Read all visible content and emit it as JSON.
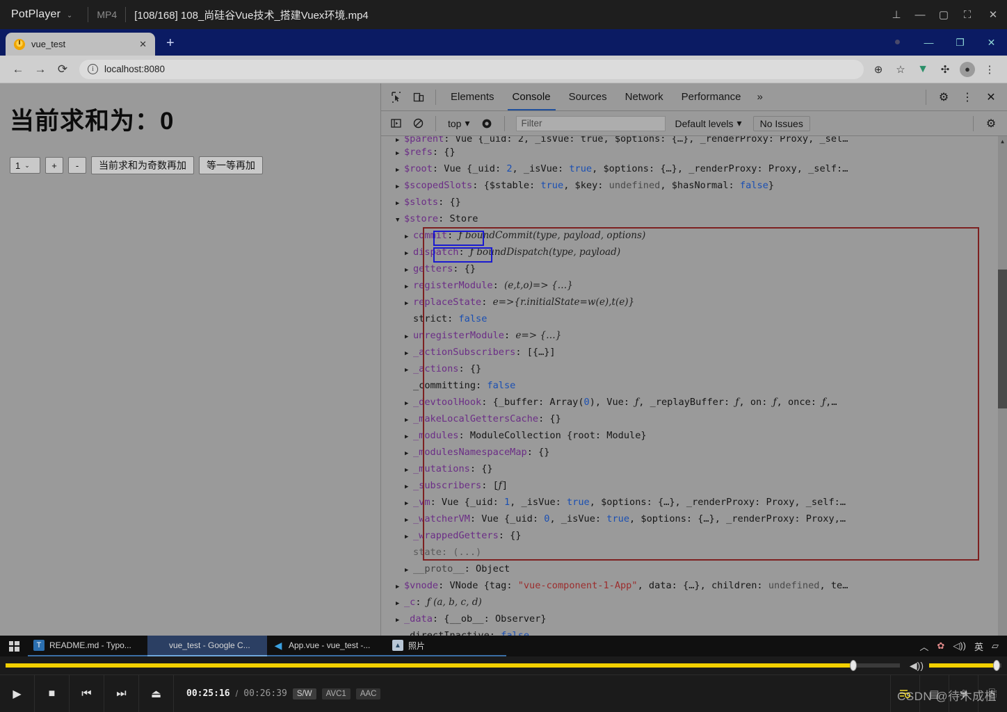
{
  "potplayer": {
    "app_name": "PotPlayer",
    "caret": "⌄",
    "format": "MP4",
    "title": "[108/168] 108_尚硅谷Vue技术_搭建Vuex环境.mp4",
    "window_buttons": [
      {
        "name": "pin",
        "glyph": "⊥"
      },
      {
        "name": "minimize",
        "glyph": "—"
      },
      {
        "name": "maximize",
        "glyph": "▢"
      },
      {
        "name": "fullscreen",
        "glyph": "⛶"
      },
      {
        "name": "close",
        "glyph": "✕"
      }
    ],
    "controls": {
      "play": "▶",
      "stop": "■",
      "previous": "⏮",
      "next": "⏭",
      "eject": "⏏",
      "current_time": "00:25:16",
      "separator": "/",
      "total_time": "00:26:39",
      "chips": [
        "S/W",
        "AVC1",
        "AAC"
      ],
      "seek_percent": 94.8,
      "volume_percent": 93,
      "volume_icon": "🔊",
      "right_icons": [
        "playlist-icon",
        "bookmark-icon",
        "settings-icon",
        "expand-icon"
      ]
    },
    "watermark": "CSDN @待木成植"
  },
  "chrome": {
    "tab": {
      "title": "vue_test",
      "close": "✕"
    },
    "new_tab": "+",
    "window_buttons": [
      {
        "name": "record",
        "glyph": "●"
      },
      {
        "name": "minimize",
        "glyph": "—"
      },
      {
        "name": "restore",
        "glyph": "❐"
      },
      {
        "name": "close",
        "glyph": "✕"
      }
    ],
    "toolbar": {
      "back": "←",
      "forward": "→",
      "reload": "⟳",
      "url": "localhost:8080",
      "info_glyph": "ⓘ",
      "zoom": "⊕",
      "bookmark": "☆",
      "vue_devtools": "V",
      "extensions": "🧩",
      "profile": "👤",
      "menu": "⋮"
    }
  },
  "page": {
    "heading": "当前求和为：0",
    "select_value": "1",
    "select_caret": "⌄",
    "buttons": [
      {
        "name": "increment",
        "label": "+"
      },
      {
        "name": "decrement",
        "label": "-"
      },
      {
        "name": "increment-if-odd",
        "label": "当前求和为奇数再加"
      },
      {
        "name": "increment-async",
        "label": "等一等再加"
      }
    ]
  },
  "devtools": {
    "tabs": [
      {
        "label": "Elements",
        "active": false
      },
      {
        "label": "Console",
        "active": true
      },
      {
        "label": "Sources",
        "active": false
      },
      {
        "label": "Network",
        "active": false
      },
      {
        "label": "Performance",
        "active": false
      }
    ],
    "more_tabs": "»",
    "settings_icon": "⚙",
    "kebab_icon": "⋮",
    "close_icon": "✕",
    "toolbar": {
      "sidebar_toggle": "▣",
      "clear_console": "🚫",
      "context": "top",
      "context_caret": "▾",
      "eye_icon": "◉",
      "filter_placeholder": "Filter",
      "levels_label": "Default levels",
      "levels_caret": "▾",
      "issues_label": "No Issues",
      "console_settings": "⚙"
    },
    "console_lines": [
      {
        "indent": 1,
        "arrow": "closed",
        "clipped": true,
        "parts": [
          {
            "t": "$parent",
            "c": "k"
          },
          {
            "t": ": ",
            "c": "plain"
          },
          {
            "t": "Vue {_uid: 2, _isVue: true, $options: {…}, _renderProxy: Proxy, _sel…",
            "c": "plain"
          }
        ]
      },
      {
        "indent": 1,
        "arrow": "closed",
        "parts": [
          {
            "t": "$refs",
            "c": "k"
          },
          {
            "t": ": {}",
            "c": "plain"
          }
        ]
      },
      {
        "indent": 1,
        "arrow": "closed",
        "parts": [
          {
            "t": "$root",
            "c": "k"
          },
          {
            "t": ": Vue {_uid: ",
            "c": "plain"
          },
          {
            "t": "2",
            "c": "num"
          },
          {
            "t": ", _isVue: ",
            "c": "plain"
          },
          {
            "t": "true",
            "c": "bool"
          },
          {
            "t": ", $options: {…}, _renderProxy: Proxy, _self:…",
            "c": "plain"
          }
        ]
      },
      {
        "indent": 1,
        "arrow": "closed",
        "parts": [
          {
            "t": "$scopedSlots",
            "c": "k"
          },
          {
            "t": ": {$stable: ",
            "c": "plain"
          },
          {
            "t": "true",
            "c": "bool"
          },
          {
            "t": ", $key: ",
            "c": "plain"
          },
          {
            "t": "undefined",
            "c": "undef"
          },
          {
            "t": ", $hasNormal: ",
            "c": "plain"
          },
          {
            "t": "false",
            "c": "bool"
          },
          {
            "t": "}",
            "c": "plain"
          }
        ]
      },
      {
        "indent": 1,
        "arrow": "closed",
        "parts": [
          {
            "t": "$slots",
            "c": "k"
          },
          {
            "t": ": {}",
            "c": "plain"
          }
        ]
      },
      {
        "indent": 1,
        "arrow": "open",
        "parts": [
          {
            "t": "$store",
            "c": "k"
          },
          {
            "t": ": Store",
            "c": "plain"
          }
        ]
      },
      {
        "indent": 2,
        "arrow": "closed",
        "parts": [
          {
            "t": "commit",
            "c": "k"
          },
          {
            "t": ": ",
            "c": "plain"
          },
          {
            "t": "ƒ",
            "c": "fnkw"
          },
          {
            "t": " boundCommit(type, payload, options)",
            "c": "fn"
          }
        ]
      },
      {
        "indent": 2,
        "arrow": "closed",
        "parts": [
          {
            "t": "dispatch",
            "c": "k"
          },
          {
            "t": ": ",
            "c": "plain"
          },
          {
            "t": "ƒ",
            "c": "fnkw"
          },
          {
            "t": " boundDispatch(type, payload)",
            "c": "fn"
          }
        ]
      },
      {
        "indent": 2,
        "arrow": "closed",
        "parts": [
          {
            "t": "getters",
            "c": "k"
          },
          {
            "t": ": {}",
            "c": "plain"
          }
        ]
      },
      {
        "indent": 2,
        "arrow": "closed",
        "parts": [
          {
            "t": "registerModule",
            "c": "k"
          },
          {
            "t": ": ",
            "c": "plain"
          },
          {
            "t": "(e,t,o)=> {…}",
            "c": "fn"
          }
        ]
      },
      {
        "indent": 2,
        "arrow": "closed",
        "parts": [
          {
            "t": "replaceState",
            "c": "k"
          },
          {
            "t": ": ",
            "c": "plain"
          },
          {
            "t": "e=>{r.initialState=w(e),t(e)}",
            "c": "fn"
          }
        ]
      },
      {
        "indent": 2,
        "arrow": "none",
        "parts": [
          {
            "t": "strict",
            "c": "plain"
          },
          {
            "t": ": ",
            "c": "plain"
          },
          {
            "t": "false",
            "c": "bool"
          }
        ]
      },
      {
        "indent": 2,
        "arrow": "closed",
        "parts": [
          {
            "t": "unregisterModule",
            "c": "k"
          },
          {
            "t": ": ",
            "c": "plain"
          },
          {
            "t": "e=> {…}",
            "c": "fn"
          }
        ]
      },
      {
        "indent": 2,
        "arrow": "closed",
        "parts": [
          {
            "t": "_actionSubscribers",
            "c": "k"
          },
          {
            "t": ": [{…}]",
            "c": "plain"
          }
        ]
      },
      {
        "indent": 2,
        "arrow": "closed",
        "parts": [
          {
            "t": "_actions",
            "c": "k"
          },
          {
            "t": ": {}",
            "c": "plain"
          }
        ]
      },
      {
        "indent": 2,
        "arrow": "none",
        "parts": [
          {
            "t": "_committing",
            "c": "plain"
          },
          {
            "t": ": ",
            "c": "plain"
          },
          {
            "t": "false",
            "c": "bool"
          }
        ]
      },
      {
        "indent": 2,
        "arrow": "closed",
        "parts": [
          {
            "t": "_devtoolHook",
            "c": "k"
          },
          {
            "t": ": {_buffer: Array(",
            "c": "plain"
          },
          {
            "t": "0",
            "c": "num"
          },
          {
            "t": "), Vue: ",
            "c": "plain"
          },
          {
            "t": "ƒ",
            "c": "fnkw"
          },
          {
            "t": ", _replayBuffer: ",
            "c": "plain"
          },
          {
            "t": "ƒ",
            "c": "fnkw"
          },
          {
            "t": ", on: ",
            "c": "plain"
          },
          {
            "t": "ƒ",
            "c": "fnkw"
          },
          {
            "t": ", once: ",
            "c": "plain"
          },
          {
            "t": "ƒ",
            "c": "fnkw"
          },
          {
            "t": ",…",
            "c": "plain"
          }
        ]
      },
      {
        "indent": 2,
        "arrow": "closed",
        "parts": [
          {
            "t": "_makeLocalGettersCache",
            "c": "k"
          },
          {
            "t": ": {}",
            "c": "plain"
          }
        ]
      },
      {
        "indent": 2,
        "arrow": "closed",
        "parts": [
          {
            "t": "_modules",
            "c": "k"
          },
          {
            "t": ": ModuleCollection {root: Module}",
            "c": "plain"
          }
        ]
      },
      {
        "indent": 2,
        "arrow": "closed",
        "parts": [
          {
            "t": "_modulesNamespaceMap",
            "c": "k"
          },
          {
            "t": ": {}",
            "c": "plain"
          }
        ]
      },
      {
        "indent": 2,
        "arrow": "closed",
        "parts": [
          {
            "t": "_mutations",
            "c": "k"
          },
          {
            "t": ": {}",
            "c": "plain"
          }
        ]
      },
      {
        "indent": 2,
        "arrow": "closed",
        "parts": [
          {
            "t": "_subscribers",
            "c": "k"
          },
          {
            "t": ": [",
            "c": "plain"
          },
          {
            "t": "ƒ",
            "c": "fnkw"
          },
          {
            "t": "]",
            "c": "plain"
          }
        ]
      },
      {
        "indent": 2,
        "arrow": "closed",
        "parts": [
          {
            "t": "_vm",
            "c": "k"
          },
          {
            "t": ": Vue {_uid: ",
            "c": "plain"
          },
          {
            "t": "1",
            "c": "num"
          },
          {
            "t": ", _isVue: ",
            "c": "plain"
          },
          {
            "t": "true",
            "c": "bool"
          },
          {
            "t": ", $options: {…}, _renderProxy: Proxy, _self:…",
            "c": "plain"
          }
        ]
      },
      {
        "indent": 2,
        "arrow": "closed",
        "parts": [
          {
            "t": "_watcherVM",
            "c": "k"
          },
          {
            "t": ": Vue {_uid: ",
            "c": "plain"
          },
          {
            "t": "0",
            "c": "num"
          },
          {
            "t": ", _isVue: ",
            "c": "plain"
          },
          {
            "t": "true",
            "c": "bool"
          },
          {
            "t": ", $options: {…}, _renderProxy: Proxy,…",
            "c": "plain"
          }
        ]
      },
      {
        "indent": 2,
        "arrow": "closed",
        "parts": [
          {
            "t": "_wrappedGetters",
            "c": "k"
          },
          {
            "t": ": {}",
            "c": "plain"
          }
        ]
      },
      {
        "indent": 2,
        "arrow": "none",
        "parts": [
          {
            "t": "state",
            "c": "dim"
          },
          {
            "t": ": (...)",
            "c": "dim"
          }
        ]
      },
      {
        "indent": 2,
        "arrow": "closed",
        "parts": [
          {
            "t": "__proto__",
            "c": "kd"
          },
          {
            "t": ": Object",
            "c": "plain"
          }
        ]
      },
      {
        "indent": 1,
        "arrow": "closed",
        "parts": [
          {
            "t": "$vnode",
            "c": "k"
          },
          {
            "t": ": VNode {tag: ",
            "c": "plain"
          },
          {
            "t": "\"vue-component-1-App\"",
            "c": "str"
          },
          {
            "t": ", data: {…}, children: ",
            "c": "plain"
          },
          {
            "t": "undefined",
            "c": "undef"
          },
          {
            "t": ", te…",
            "c": "plain"
          }
        ]
      },
      {
        "indent": 1,
        "arrow": "closed",
        "parts": [
          {
            "t": "_c",
            "c": "k"
          },
          {
            "t": ": ",
            "c": "plain"
          },
          {
            "t": "ƒ",
            "c": "fnkw"
          },
          {
            "t": " (a, b, c, d)",
            "c": "fn"
          }
        ]
      },
      {
        "indent": 1,
        "arrow": "closed",
        "parts": [
          {
            "t": "_data",
            "c": "k"
          },
          {
            "t": ": {__ob__: Observer}",
            "c": "plain"
          }
        ]
      },
      {
        "indent": 1,
        "arrow": "none",
        "clipped_bottom": true,
        "parts": [
          {
            "t": "_directInactive",
            "c": "plain"
          },
          {
            "t": ": ",
            "c": "plain"
          },
          {
            "t": "false",
            "c": "bool"
          }
        ]
      }
    ],
    "annotations": {
      "red_box": "store-properties-highlight",
      "blue_boxes": [
        "commit-highlight",
        "dispatch-highlight"
      ]
    }
  },
  "taskbar": {
    "start": "windows-logo",
    "tasks": [
      {
        "name": "typora",
        "label": "README.md - Typo...",
        "active": false
      },
      {
        "name": "chrome",
        "label": "vue_test - Google C...",
        "active": true
      },
      {
        "name": "vscode",
        "label": "App.vue - vue_test -...",
        "active": false
      },
      {
        "name": "photos",
        "label": "照片",
        "active": false
      }
    ],
    "tray": [
      {
        "name": "show-hidden-icons",
        "glyph": "︿"
      },
      {
        "name": "flower-icon",
        "glyph": "✿"
      },
      {
        "name": "volume-icon",
        "glyph": "🔊"
      },
      {
        "name": "ime-indicator",
        "glyph": "英"
      },
      {
        "name": "action-center-icon",
        "glyph": "▭"
      }
    ]
  }
}
